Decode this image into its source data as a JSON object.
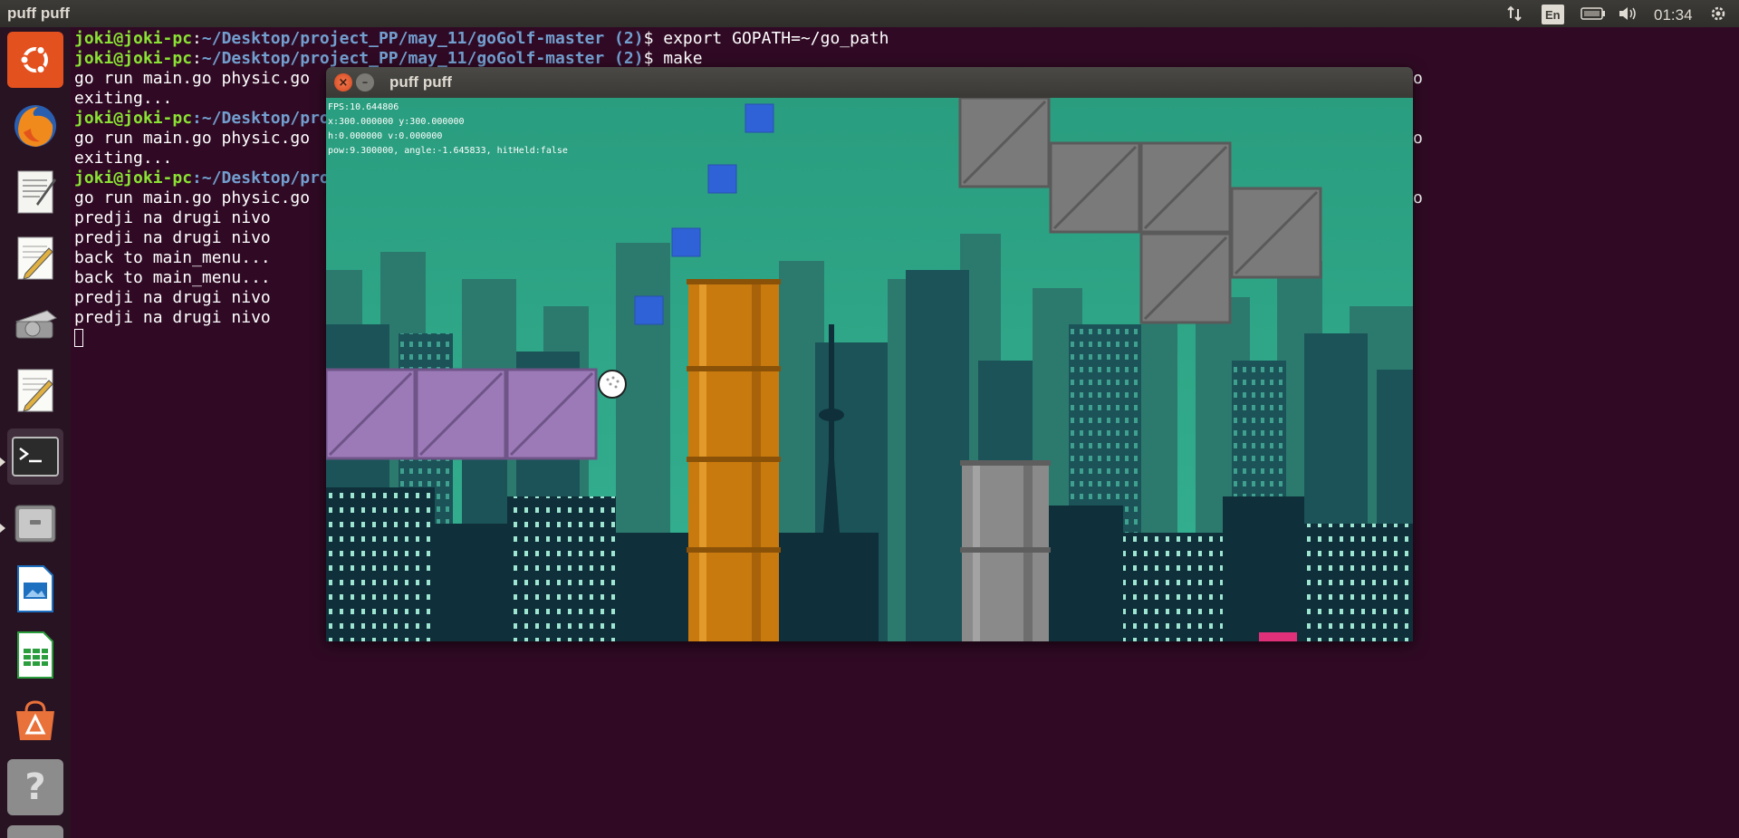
{
  "topbar": {
    "title": "puff puff",
    "language": "En",
    "clock": "01:34",
    "icons": [
      "network-transfer-icon",
      "keyboard-layout-icon",
      "battery-icon",
      "volume-icon",
      "power-gear-icon"
    ]
  },
  "launcher": {
    "items": [
      {
        "name": "ubuntu-dash-icon"
      },
      {
        "name": "firefox-icon"
      },
      {
        "name": "text-editor-icon"
      },
      {
        "name": "gedit-icon"
      },
      {
        "name": "scanner-icon"
      },
      {
        "name": "gedit-icon-2"
      },
      {
        "name": "terminal-icon"
      },
      {
        "name": "file-manager-icon"
      },
      {
        "name": "libreoffice-impress-icon"
      },
      {
        "name": "libreoffice-calc-icon"
      },
      {
        "name": "software-center-icon"
      },
      {
        "name": "help-icon"
      }
    ]
  },
  "terminal": {
    "prompt_user": "joki@joki-pc",
    "prompt_sep": ":",
    "prompt_path": "~/Desktop/project_PP/may_11/goGolf-master (2)",
    "prompt_dollar": "$",
    "lines": [
      {
        "type": "prompt",
        "cmd": " export GOPATH=~/go_path"
      },
      {
        "type": "prompt",
        "cmd": " make"
      },
      {
        "type": "out",
        "text": "go run main.go physic.go"
      },
      {
        "type": "out",
        "text": "exiting..."
      },
      {
        "type": "prompt-cut",
        "text": "joki@joki-pc:~/Desktop/pro"
      },
      {
        "type": "out",
        "text": "go run main.go physic.go"
      },
      {
        "type": "out",
        "text": "exiting..."
      },
      {
        "type": "prompt-cut",
        "text": "joki@joki-pc:~/Desktop/pro"
      },
      {
        "type": "out",
        "text": "go run main.go physic.go"
      },
      {
        "type": "out",
        "text": "predji na drugi nivo"
      },
      {
        "type": "out",
        "text": "predji na drugi nivo"
      },
      {
        "type": "out",
        "text": "back to main_menu..."
      },
      {
        "type": "out",
        "text": "back to main_menu..."
      },
      {
        "type": "out",
        "text": "predji na drugi nivo"
      },
      {
        "type": "out",
        "text": "predji na drugi nivo"
      }
    ],
    "right_edge_chars": [
      "o",
      "o",
      "o"
    ]
  },
  "game_window": {
    "title": "puff puff",
    "close_glyph": "×",
    "min_glyph": "–",
    "debug": {
      "fps": "FPS:10.644806",
      "pos": "x:300.000000 y:300.000000",
      "vel": "h:0.000000 v:0.000000",
      "state": "pow:9.300000, angle:-1.645833, hitHeld:false"
    },
    "colors": {
      "sky": "#2f9f82",
      "city_far": "#2c7a6e",
      "city_mid": "#1b5358",
      "city_near": "#0f2f3a",
      "crate_gray": "#7a7a7a",
      "crate_purple": "#9c7ab8",
      "pipe_orange": "#c97a0e",
      "pipe_gray": "#8a8a8a",
      "aim_blue": "#2f62d6",
      "hole_pink": "#e0307a"
    }
  }
}
